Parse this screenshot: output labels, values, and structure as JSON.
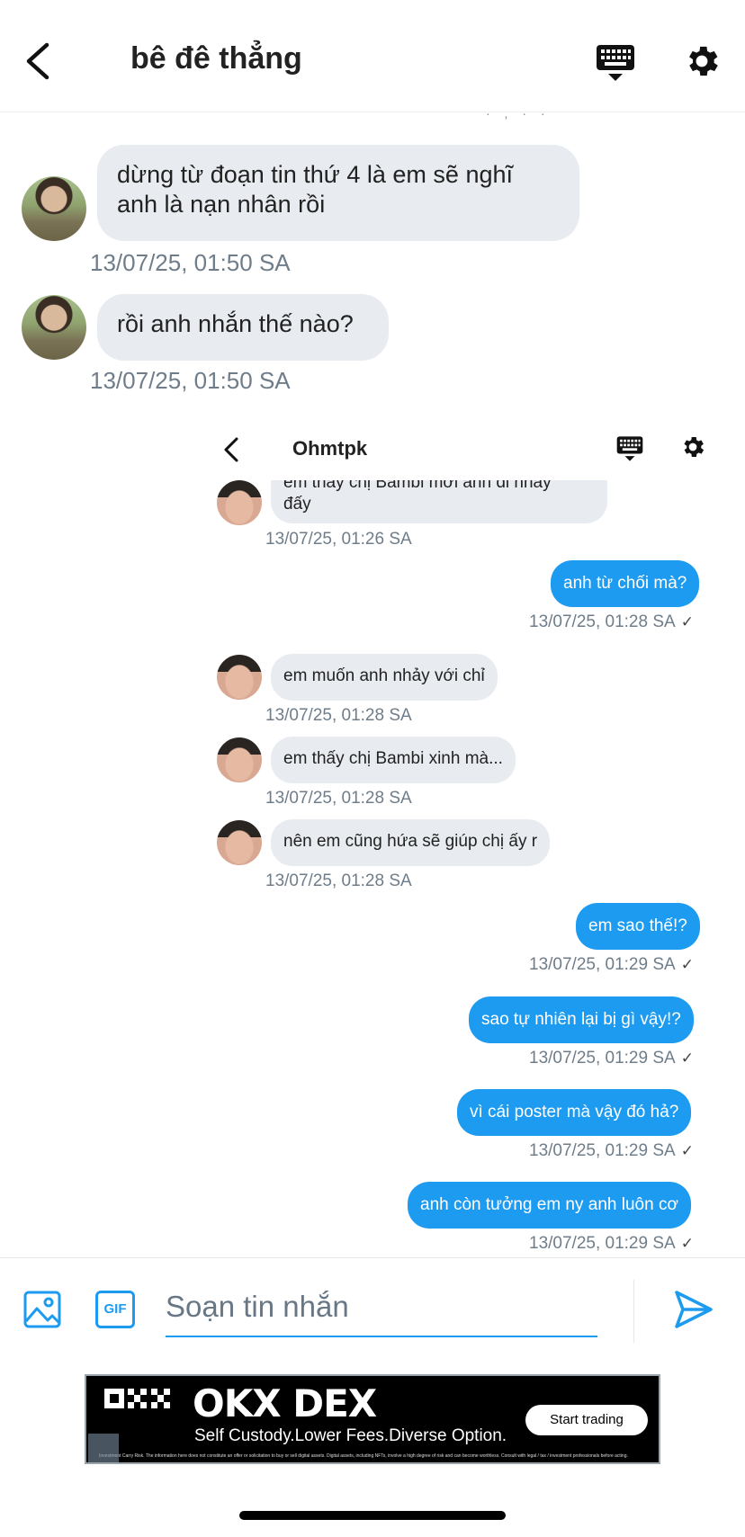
{
  "header": {
    "title": "bê đê thẳng",
    "peek_timestamp": "· , · ·"
  },
  "outer_messages": [
    {
      "text_line1": "dừng từ đoạn tin thứ 4 là em sẽ nghĩ",
      "text_line2": "anh là nạn nhân rồi",
      "timestamp": "13/07/25, 01:50 SA"
    },
    {
      "text": "rồi anh nhắn thế nào?",
      "timestamp": "13/07/25, 01:50 SA"
    }
  ],
  "inner": {
    "title": "Ohmtpk",
    "partial_message": {
      "line1": "em thấy chị Bambi mời anh đi nhảy",
      "line2": "đấy",
      "timestamp": "13/07/25, 01:26 SA"
    },
    "messages": [
      {
        "dir": "out",
        "text": "anh từ chối mà?",
        "timestamp": "13/07/25, 01:28 SA"
      },
      {
        "dir": "in",
        "text": "em muốn anh nhảy với chỉ",
        "timestamp": "13/07/25, 01:28 SA"
      },
      {
        "dir": "in",
        "text": "em thấy chị Bambi xinh mà...",
        "timestamp": "13/07/25, 01:28 SA"
      },
      {
        "dir": "in",
        "text": "nên em cũng hứa sẽ giúp chị ấy r",
        "timestamp": "13/07/25, 01:28 SA"
      },
      {
        "dir": "out",
        "text": "em sao thế!?",
        "timestamp": "13/07/25, 01:29 SA"
      },
      {
        "dir": "out",
        "text": "sao tự nhiên lại bị gì vậy!?",
        "timestamp": "13/07/25, 01:29 SA"
      },
      {
        "dir": "out",
        "text": "vì cái poster mà vậy đó hả?",
        "timestamp": "13/07/25, 01:29 SA"
      },
      {
        "dir": "out",
        "text": "anh còn tưởng em ny anh luôn cơ",
        "timestamp": "13/07/25, 01:29 SA"
      }
    ],
    "read_check": "✓"
  },
  "composer": {
    "placeholder": "Soạn tin nhắn",
    "gif_label": "GIF"
  },
  "ad": {
    "brand": "OKX DEX",
    "tagline": "Self Custody.Lower Fees.Diverse Option.",
    "cta": "Start trading",
    "fine_print": "Investment Carry Risk. The information here does not constitute an offer or solicitation to buy or sell digital assets. Digital assets, including NFTs, involve a high degree of risk and can become worthless. Consult with legal / tax / investment professionals before acting."
  },
  "colors": {
    "accent": "#1d9bf0",
    "bubble_in": "#e8ecf0",
    "timestamp": "#6f7d8a"
  },
  "icons": [
    "chevron-left-icon",
    "keyboard-icon",
    "gear-icon",
    "image-icon",
    "gif-icon",
    "send-icon",
    "okx-logo-icon"
  ]
}
